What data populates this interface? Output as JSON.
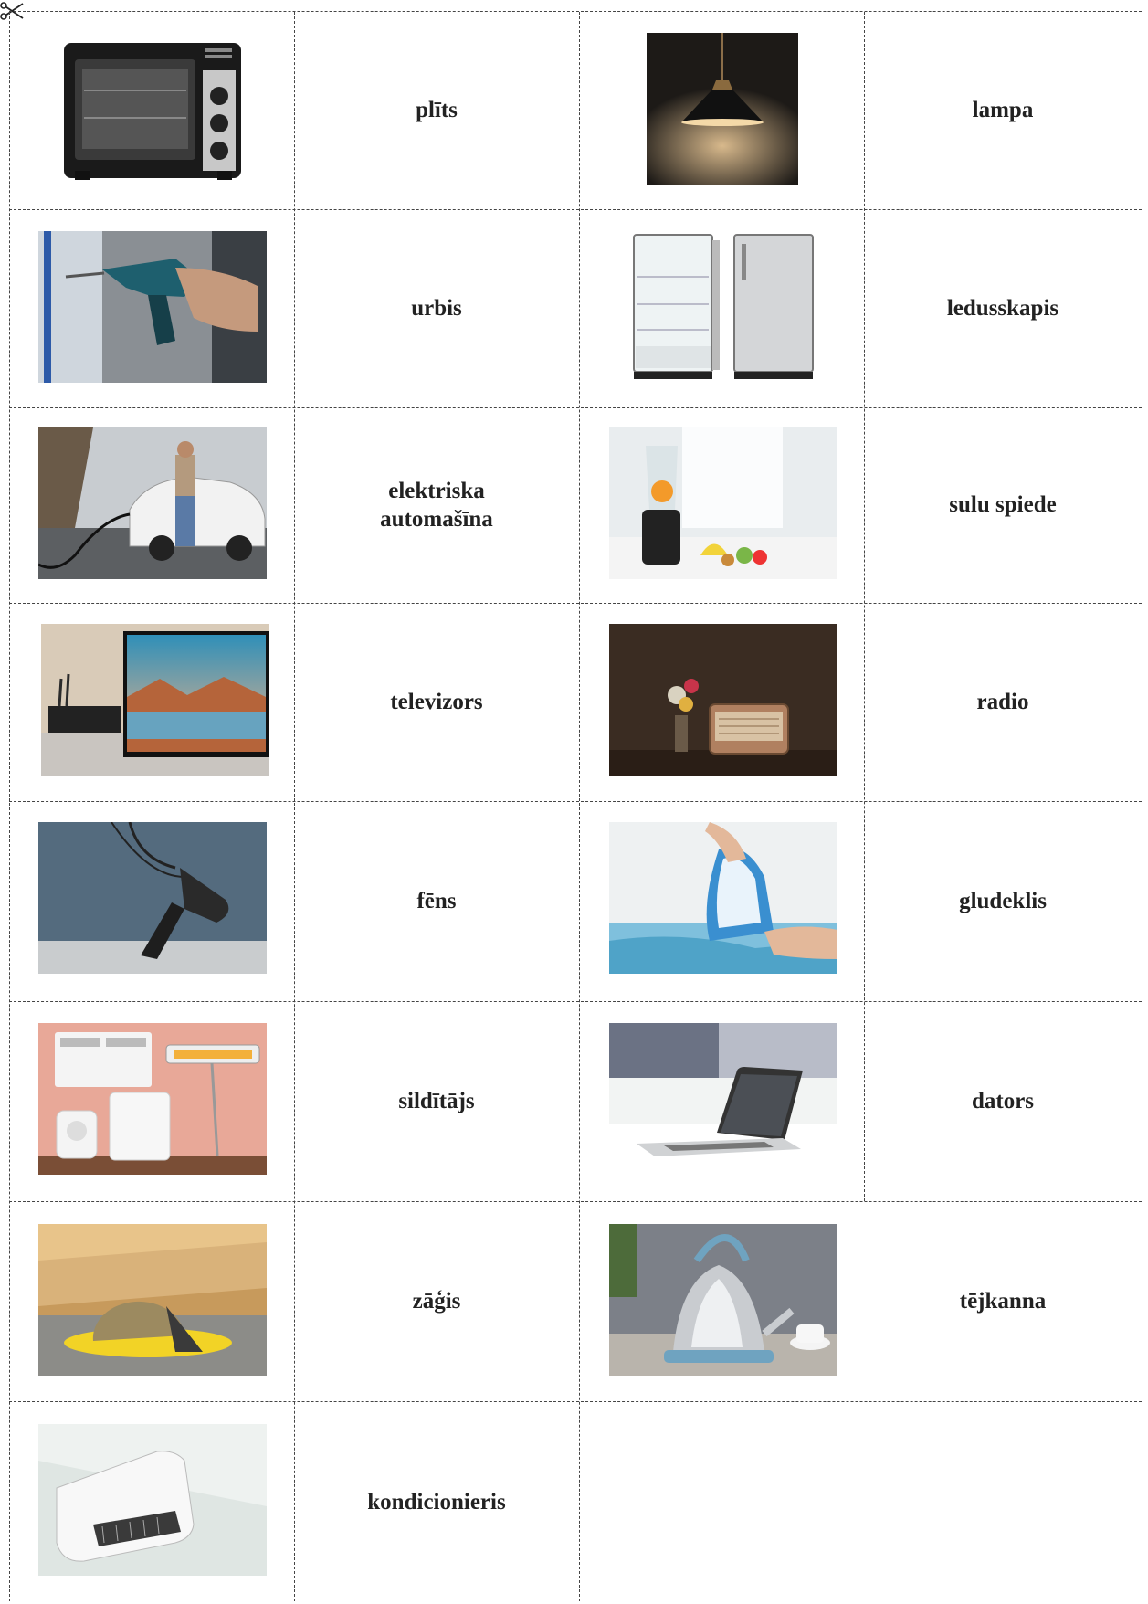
{
  "cards": [
    {
      "label": "plīts",
      "picture": "oven"
    },
    {
      "label": "lampa",
      "picture": "lamp"
    },
    {
      "label": "urbis",
      "picture": "drill"
    },
    {
      "label": "ledusskapis",
      "picture": "fridge"
    },
    {
      "label": "elektriska\nautomašīna",
      "picture": "electric-car"
    },
    {
      "label": "sulu spiede",
      "picture": "blender"
    },
    {
      "label": "televizors",
      "picture": "tv"
    },
    {
      "label": "radio",
      "picture": "radio"
    },
    {
      "label": "fēns",
      "picture": "hair-dryer"
    },
    {
      "label": "gludeklis",
      "picture": "iron"
    },
    {
      "label": "sildītājs",
      "picture": "heater"
    },
    {
      "label": "dators",
      "picture": "laptop"
    },
    {
      "label": "zāģis",
      "picture": "saw"
    },
    {
      "label": "tējkanna",
      "picture": "kettle"
    },
    {
      "label": "kondicionieris",
      "picture": "air-conditioner"
    }
  ]
}
